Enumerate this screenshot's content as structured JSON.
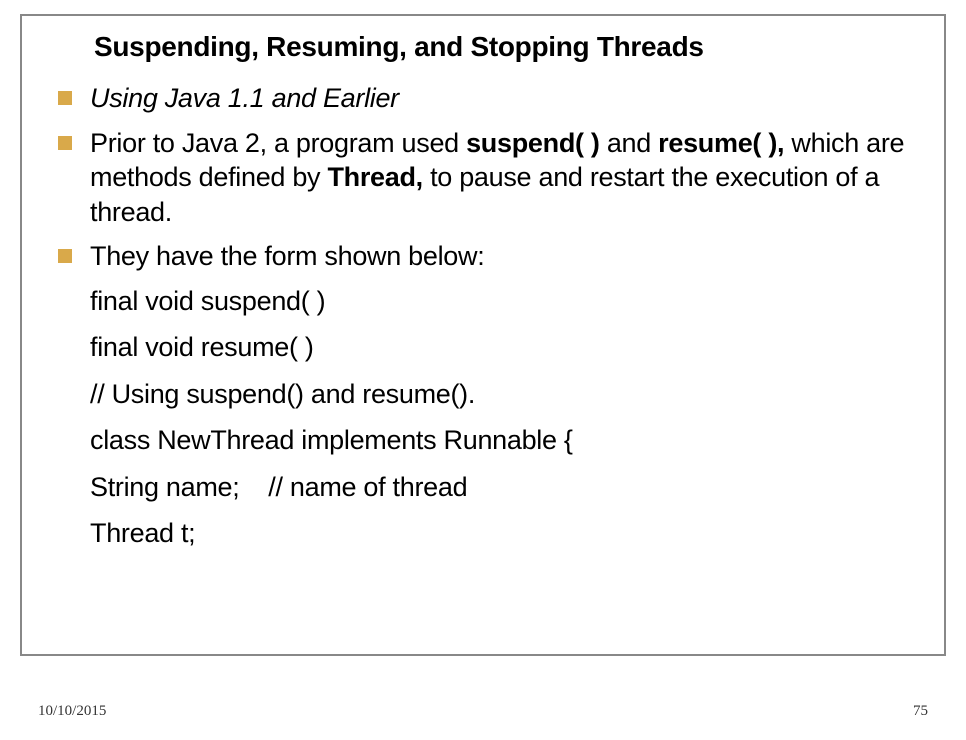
{
  "slide": {
    "title": "Suspending, Resuming, and Stopping Threads",
    "bullets": [
      {
        "segments": [
          {
            "text": "Using Java 1.1 and Earlier",
            "style": "italic"
          }
        ]
      },
      {
        "segments": [
          {
            "text": "Prior to Java 2, a program used ",
            "style": ""
          },
          {
            "text": "suspend( ) ",
            "style": "bold"
          },
          {
            "text": "and ",
            "style": ""
          },
          {
            "text": "resume( ),",
            "style": "bold"
          },
          {
            "text": " which are methods defined by ",
            "style": ""
          },
          {
            "text": "Thread,",
            "style": "bold"
          },
          {
            "text": " to pause and restart the execution of a thread.",
            "style": ""
          }
        ]
      },
      {
        "segments": [
          {
            "text": "They have the form shown below:",
            "style": ""
          }
        ]
      }
    ],
    "code_lines": [
      "final void suspend( )",
      "final void resume( )",
      "// Using suspend() and resume().",
      "class NewThread implements Runnable {",
      "String name;    // name of thread",
      "Thread t;"
    ]
  },
  "footer": {
    "date": "10/10/2015",
    "page": "75"
  }
}
